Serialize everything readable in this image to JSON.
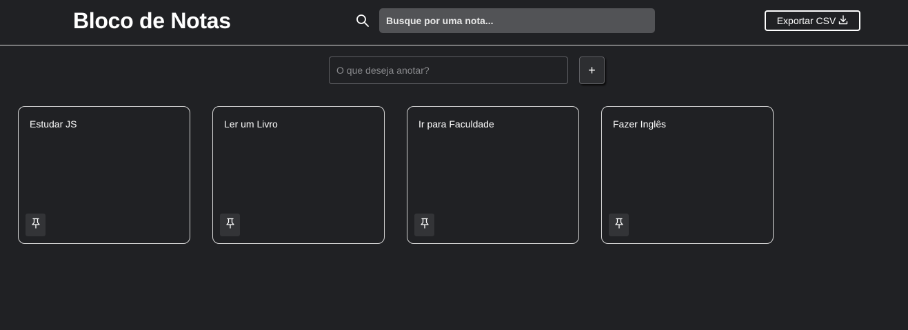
{
  "app": {
    "title": "Bloco de Notas"
  },
  "header": {
    "search_icon": "search-icon",
    "search_placeholder": "Busque por uma nota...",
    "export_label": "Exportar CSV",
    "export_icon": "download-icon"
  },
  "composer": {
    "placeholder": "O que deseja anotar?",
    "add_label": "+"
  },
  "notes": [
    {
      "text": "Estudar JS",
      "icon": "pin-icon"
    },
    {
      "text": "Ler um Livro",
      "icon": "pin-icon"
    },
    {
      "text": "Ir para Faculdade",
      "icon": "pin-icon"
    },
    {
      "text": "Fazer Inglês",
      "icon": "pin-icon"
    }
  ],
  "colors": {
    "background": "#202124",
    "search_bg": "#525356",
    "border": "#d6d6d6",
    "text": "#ffffff"
  }
}
